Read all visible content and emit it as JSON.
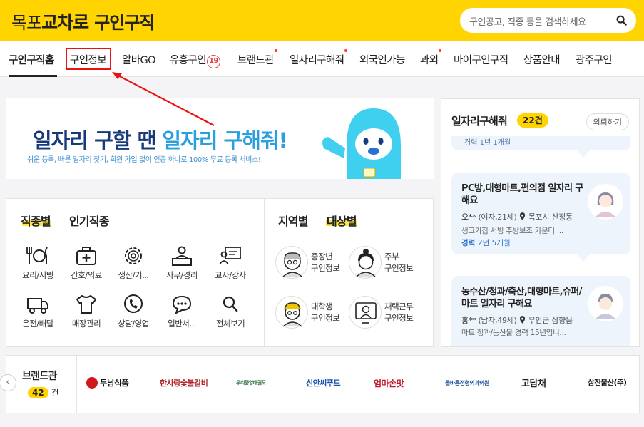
{
  "header": {
    "logo_prefix": "목포",
    "logo_brand": "교차로",
    "logo_suffix": "구인구직",
    "search_placeholder": "구인공고, 직종 등을 검색하세요"
  },
  "nav": {
    "items": [
      {
        "label": "구인구직홈"
      },
      {
        "label": "구인정보"
      },
      {
        "label": "알바GO"
      },
      {
        "label": "유흥구인"
      },
      {
        "label": "브랜드관"
      },
      {
        "label": "일자리구해줘"
      },
      {
        "label": "외국인가능"
      },
      {
        "label": "과외"
      },
      {
        "label": "마이구인구직"
      },
      {
        "label": "상품안내"
      },
      {
        "label": "광주구인"
      }
    ],
    "adult_badge": "19"
  },
  "banner": {
    "title_a": "일자리 구할 땐 ",
    "title_b": "일자리 구해줘!",
    "subtitle": "쉬운 등록, 빠른 일자리 찾기, 회원 가입 없이 인증 하나로 100% 무료 등록 서비스!"
  },
  "categories": {
    "tab_job": "직종별",
    "tab_popular": "인기직종",
    "tab_region": "지역별",
    "tab_target": "대상별",
    "items": [
      {
        "label": "요리/서빙"
      },
      {
        "label": "간호/의료"
      },
      {
        "label": "생산/기..."
      },
      {
        "label": "사무/경리"
      },
      {
        "label": "교사/강사"
      },
      {
        "label": "운전/배달"
      },
      {
        "label": "매장관리"
      },
      {
        "label": "상담/영업"
      },
      {
        "label": "일반서..."
      },
      {
        "label": "전체보기"
      }
    ],
    "targets": [
      {
        "line1": "중장년",
        "line2": "구인정보"
      },
      {
        "line1": "주부",
        "line2": "구인정보"
      },
      {
        "line1": "대학생",
        "line2": "구인정보"
      },
      {
        "line1": "재택근무",
        "line2": "구인정보"
      }
    ]
  },
  "side": {
    "title": "일자리구해줘",
    "count": "22건",
    "request": "의뢰하기",
    "top_fragment": "경력 1년 1개월",
    "cards": [
      {
        "title": "PC방,대형마트,편의점 일자리 구해요",
        "name": "오**",
        "age": "(여자,21세)",
        "location": "목포시 산정동",
        "desc": "생고기집 서빙 주방보조 카운터 ...",
        "exp_label": "경력",
        "exp_value": "2년 5개월"
      },
      {
        "title": "농수산/청과/축산,대형마트,슈퍼/마트 일자리 구해요",
        "name": "홍**",
        "age": "(남자,49세)",
        "location": "무안군 삼향읍",
        "desc": "마트 청과/농산물 경력 15년입니..."
      }
    ]
  },
  "brand": {
    "title": "브랜드관",
    "count": "42",
    "count_unit": "건",
    "logos": [
      "두남식품",
      "한사랑숯불갈비",
      "우리중앙태권도",
      "신안씨푸드",
      "엄마손맛",
      "올바른정형외과의원",
      "고담채",
      "삼진물산(주)"
    ]
  }
}
